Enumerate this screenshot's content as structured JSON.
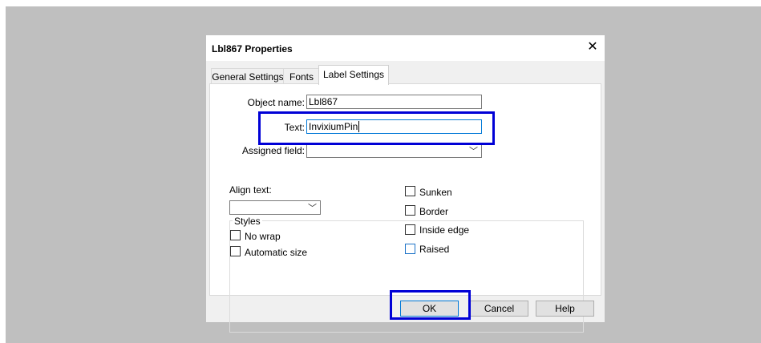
{
  "dialog": {
    "title": "Lbl867 Properties",
    "close_glyph": "✕"
  },
  "tabs": [
    {
      "label": "General Settings"
    },
    {
      "label": "Fonts"
    },
    {
      "label": "Label Settings"
    }
  ],
  "form": {
    "object_name_label": "Object name:",
    "object_name_value": "Lbl867",
    "text_label": "Text:",
    "text_value": "InvixiumPin",
    "assigned_field_label": "Assigned field:",
    "assigned_field_value": ""
  },
  "styles": {
    "group_title": "Styles",
    "align_text_label": "Align text:",
    "align_text_value": "",
    "no_wrap_label": "No wrap",
    "automatic_size_label": "Automatic size",
    "sunken_label": "Sunken",
    "border_label": "Border",
    "inside_edge_label": "Inside edge",
    "raised_label": "Raised"
  },
  "buttons": {
    "ok": "OK",
    "cancel": "Cancel",
    "help": "Help"
  },
  "colors": {
    "highlight": "#0000d6",
    "focus": "#0078d7"
  }
}
